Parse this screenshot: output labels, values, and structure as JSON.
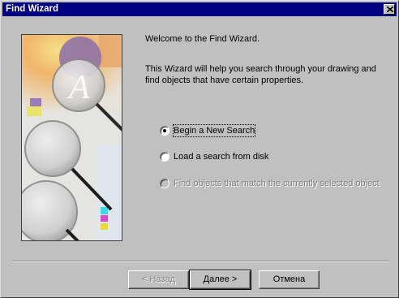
{
  "window": {
    "title": "Find Wizard"
  },
  "intro": {
    "welcome": "Welcome to the Find Wizard.",
    "description_line1": "This Wizard will help you search through your drawing and",
    "description_line2": "find objects that have certain properties."
  },
  "options": [
    {
      "label": "Begin a New Search",
      "selected": true,
      "enabled": true
    },
    {
      "label": "Load a search from disk",
      "selected": false,
      "enabled": true
    },
    {
      "label": "Find objects that match the currently selected object",
      "selected": false,
      "enabled": false
    }
  ],
  "buttons": {
    "back": {
      "label": "< Назад",
      "enabled": false
    },
    "next": {
      "label": "Далее >",
      "enabled": true
    },
    "cancel": {
      "label": "Отмена",
      "enabled": true
    }
  },
  "illustration": {
    "letter": "A"
  },
  "colors": {
    "titlebar": "#000080",
    "face": "#c0c0c0"
  }
}
